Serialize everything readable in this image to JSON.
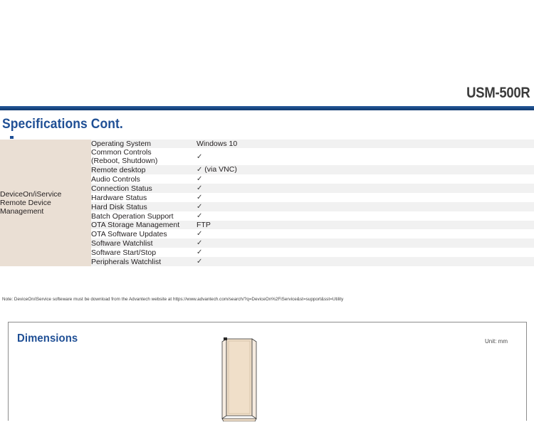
{
  "header": {
    "model": "USM-500R"
  },
  "section": {
    "title": "Specifications Cont."
  },
  "spec_table": {
    "category": "DeviceOn/iService Remote Device Management",
    "rows": [
      {
        "feature": "Operating System",
        "value": "Windows 10",
        "check": false
      },
      {
        "feature": "Common Controls (Reboot, Shutdown)",
        "value": "",
        "check": true
      },
      {
        "feature": "Remote desktop",
        "value": "(via VNC)",
        "check": true
      },
      {
        "feature": "Audio Controls",
        "value": "",
        "check": true
      },
      {
        "feature": "Connection Status",
        "value": "",
        "check": true
      },
      {
        "feature": "Hardware Status",
        "value": "",
        "check": true
      },
      {
        "feature": "Hard Disk Status",
        "value": "",
        "check": true
      },
      {
        "feature": "Batch Operation Support",
        "value": "",
        "check": true
      },
      {
        "feature": "OTA Storage Management",
        "value": "FTP",
        "check": false
      },
      {
        "feature": "OTA Software Updates",
        "value": "",
        "check": true
      },
      {
        "feature": "Software Watchlist",
        "value": "",
        "check": true
      },
      {
        "feature": "Software Start/Stop",
        "value": "",
        "check": true
      },
      {
        "feature": "Peripherals Watchlist",
        "value": "",
        "check": true
      }
    ],
    "check_glyph": "✓"
  },
  "note": {
    "text": "Note: DeviceOn/iService softeware must be download from the Advantech website at https://www.advantech.com/search/?q=DeviceOn%2FiService&st=support&sst=Utility"
  },
  "dimensions": {
    "title": "Dimensions",
    "unit": "Unit: mm"
  },
  "colors": {
    "brand_blue": "#1f4f95",
    "rule_blue": "#174681",
    "category_beige": "#eadfd4",
    "row_gray": "#f1f1f1",
    "device_fill": "#f0dfc9"
  }
}
